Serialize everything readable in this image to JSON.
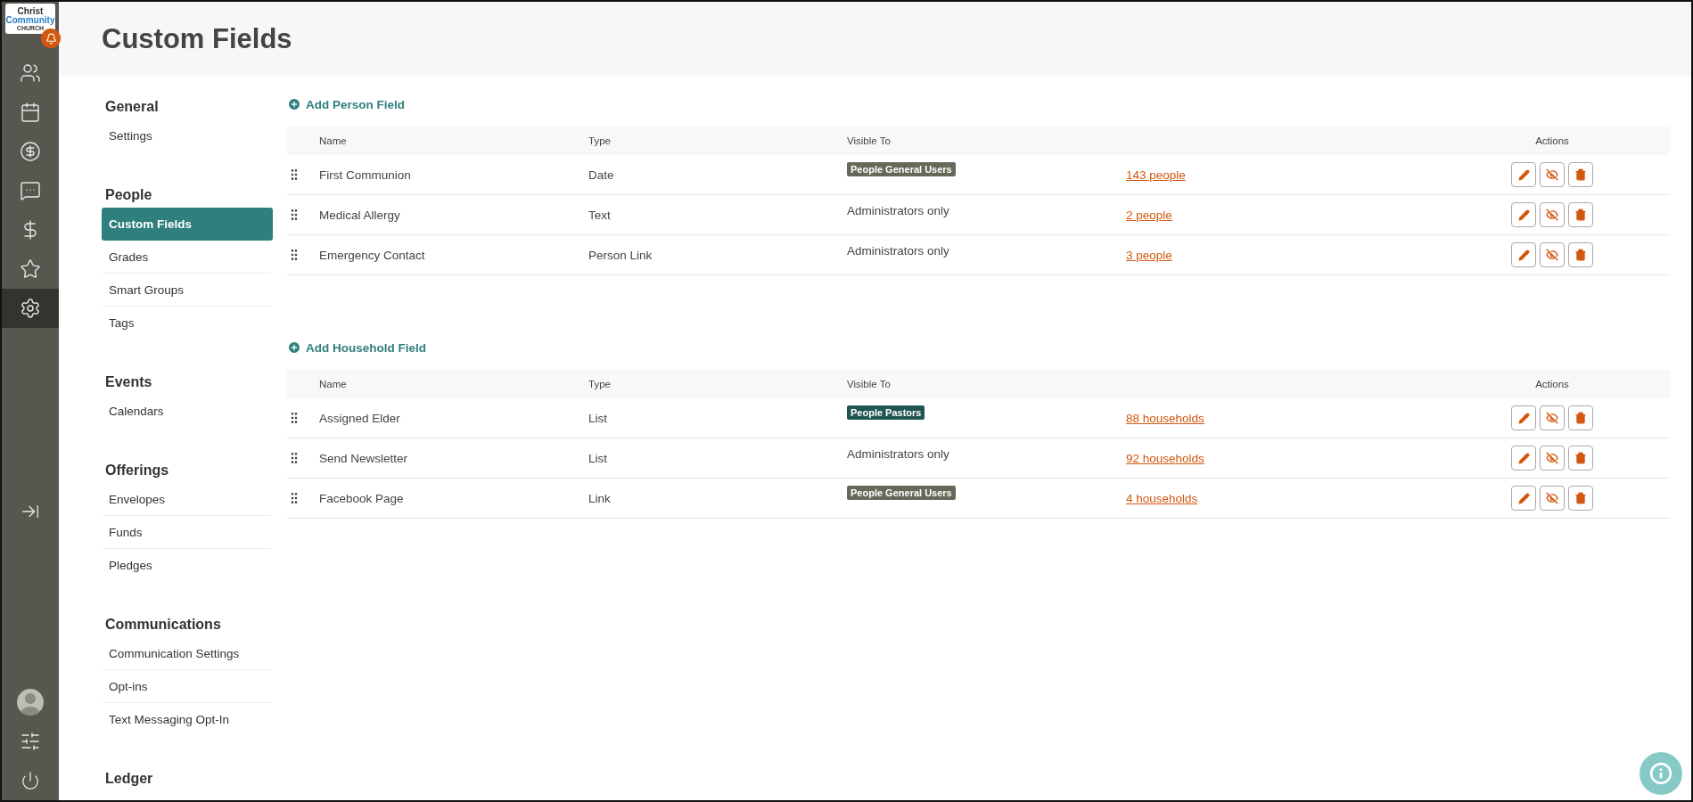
{
  "logo": {
    "lines": [
      "Christ",
      "Community",
      "CHURCH"
    ]
  },
  "rail": {
    "items": [
      {
        "kind": "people",
        "selected": false
      },
      {
        "kind": "calendar",
        "selected": false
      },
      {
        "kind": "giving",
        "selected": false
      },
      {
        "kind": "messages",
        "selected": false
      },
      {
        "kind": "dollar",
        "selected": false
      },
      {
        "kind": "star",
        "selected": false
      },
      {
        "kind": "settings",
        "selected": true
      }
    ],
    "bottom_items": [
      {
        "kind": "avatar"
      },
      {
        "kind": "sliders"
      },
      {
        "kind": "power"
      }
    ]
  },
  "page": {
    "title": "Custom Fields"
  },
  "settings_nav": [
    {
      "heading": "General",
      "items": [
        {
          "label": "Settings",
          "selected": false
        }
      ]
    },
    {
      "heading": "People",
      "items": [
        {
          "label": "Custom Fields",
          "selected": true
        },
        {
          "label": "Grades",
          "selected": false
        },
        {
          "label": "Smart Groups",
          "selected": false
        },
        {
          "label": "Tags",
          "selected": false
        }
      ]
    },
    {
      "heading": "Events",
      "items": [
        {
          "label": "Calendars",
          "selected": false
        }
      ]
    },
    {
      "heading": "Offerings",
      "items": [
        {
          "label": "Envelopes",
          "selected": false
        },
        {
          "label": "Funds",
          "selected": false
        },
        {
          "label": "Pledges",
          "selected": false
        }
      ]
    },
    {
      "heading": "Communications",
      "items": [
        {
          "label": "Communication Settings",
          "selected": false
        },
        {
          "label": "Opt-ins",
          "selected": false
        },
        {
          "label": "Text Messaging Opt-In",
          "selected": false
        }
      ]
    },
    {
      "heading": "Ledger"
    }
  ],
  "sections": [
    {
      "add_label": "Add Person Field",
      "columns": [
        "Name",
        "Type",
        "Visible To",
        "Actions"
      ],
      "rows": [
        {
          "name": "First Communion",
          "type": "Date",
          "visible_to": {
            "kind": "badge",
            "text": "People General Users",
            "color": "#68685a"
          },
          "count": "143 people"
        },
        {
          "name": "Medical Allergy",
          "type": "Text",
          "visible_to": {
            "kind": "text",
            "text": "Administrators only"
          },
          "count": "2 people"
        },
        {
          "name": "Emergency Contact",
          "type": "Person Link",
          "visible_to": {
            "kind": "text",
            "text": "Administrators only"
          },
          "count": "3 people"
        }
      ]
    },
    {
      "add_label": "Add Household Field",
      "columns": [
        "Name",
        "Type",
        "Visible To",
        "Actions"
      ],
      "rows": [
        {
          "name": "Assigned Elder",
          "type": "List",
          "visible_to": {
            "kind": "badge",
            "text": "People Pastors",
            "color": "#1f5552"
          },
          "count": "88 households"
        },
        {
          "name": "Send Newsletter",
          "type": "List",
          "visible_to": {
            "kind": "text",
            "text": "Administrators only"
          },
          "count": "92 households"
        },
        {
          "name": "Facebook Page",
          "type": "Link",
          "visible_to": {
            "kind": "badge",
            "text": "People General Users",
            "color": "#68685a"
          },
          "count": "4 households"
        }
      ]
    }
  ]
}
